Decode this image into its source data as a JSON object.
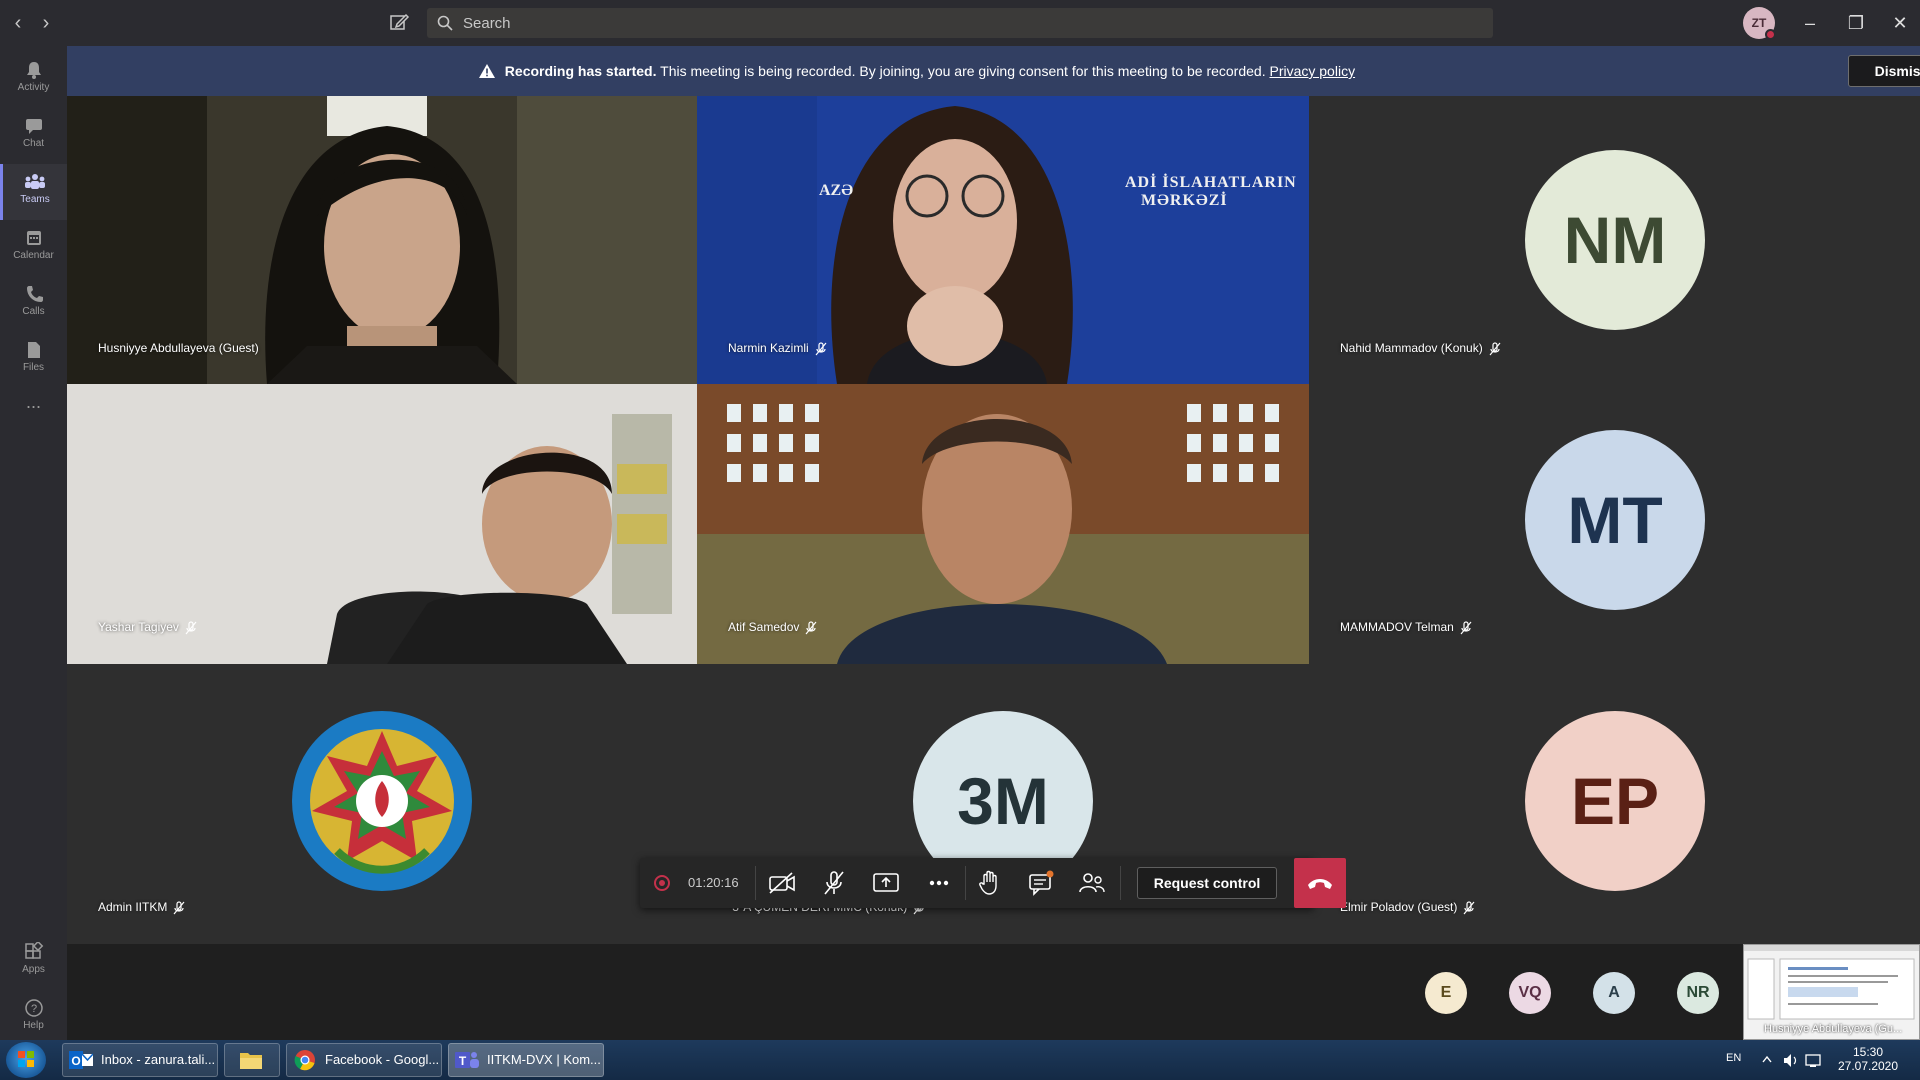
{
  "app": {
    "search_placeholder": "Search",
    "user_initials": "ZT"
  },
  "rail": {
    "items": [
      {
        "label": "Activity",
        "icon": "bell-icon"
      },
      {
        "label": "Chat",
        "icon": "chat-icon"
      },
      {
        "label": "Teams",
        "icon": "teams-icon"
      },
      {
        "label": "Calendar",
        "icon": "calendar-icon"
      },
      {
        "label": "Calls",
        "icon": "phone-icon"
      },
      {
        "label": "Files",
        "icon": "file-icon"
      },
      {
        "label": "Apps",
        "icon": "apps-icon"
      },
      {
        "label": "Help",
        "icon": "help-icon"
      }
    ],
    "more": "..."
  },
  "banner": {
    "title": "Recording has started.",
    "message": "This meeting is being recorded. By joining, you are giving consent for this meeting to be recorded.",
    "link": "Privacy policy",
    "dismiss": "Dismiss"
  },
  "participants": [
    {
      "name": "Husniyye Abdullayeva (Guest)",
      "muted": false,
      "video": true
    },
    {
      "name": "Narmin Kazimli",
      "muted": true,
      "video": true
    },
    {
      "name": "Nahid Mammadov (Konuk)",
      "muted": true,
      "initials": "NM",
      "color": "#e3ead8",
      "text_color": "#3d4a33"
    },
    {
      "name": "Yashar Tagiyev",
      "muted": true,
      "video": true
    },
    {
      "name": "Atif Samedov",
      "muted": true,
      "video": true
    },
    {
      "name": "MAMMADOV Telman",
      "muted": true,
      "initials": "MT",
      "color": "#c9d8ea",
      "text_color": "#1e3350"
    },
    {
      "name": "Admin IITKM",
      "muted": true,
      "emblem": true
    },
    {
      "name": "\"3\"A ÇÜMEN DERİ MMC (Konuk)",
      "muted": true,
      "initials": "3M",
      "color": "#d9e6ea",
      "text_color": "#243338"
    },
    {
      "name": "Elmir Poladov (Guest)",
      "muted": true,
      "initials": "EP",
      "color": "#f1d0c7",
      "text_color": "#5a2015"
    }
  ],
  "backdrop": {
    "line1": "ADİ İSLAHATLARIN",
    "line2": "MƏRKƏZİ",
    "left": "AZƏ"
  },
  "controls": {
    "timer": "01:20:16",
    "request_control": "Request control"
  },
  "overflow": [
    {
      "initials": "E",
      "color": "#f5ead0",
      "text_color": "#5a4a1d"
    },
    {
      "initials": "VQ",
      "color": "#ecd9e4",
      "text_color": "#5a2f45"
    },
    {
      "initials": "A",
      "color": "#d3e1e8",
      "text_color": "#2b3f4a"
    },
    {
      "initials": "NR",
      "color": "#dbe9e0",
      "text_color": "#2b4a36"
    }
  ],
  "thumbnail_caption": "Husniyye Abdullayeva (Gu...",
  "taskbar": {
    "tasks": [
      {
        "label": "Inbox - zanura.tali..."
      },
      {
        "label": ""
      },
      {
        "label": "Facebook - Googl..."
      },
      {
        "label": "IITKM-DVX | Kom..."
      }
    ],
    "lang": "EN",
    "time": "15:30",
    "date": "27.07.2020"
  }
}
